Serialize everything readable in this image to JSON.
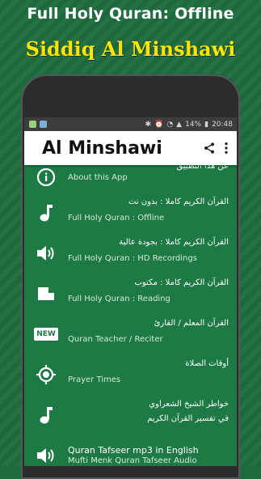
{
  "promo": {
    "title": "Full Holy Quran: Offline",
    "subtitle": "Siddiq Al Minshawi"
  },
  "status_bar": {
    "battery": "14%",
    "time": "20:48"
  },
  "app_bar": {
    "title": "Al Minshawi",
    "share_icon": "share-icon",
    "menu_icon": "more-vert-icon"
  },
  "menu": {
    "items": [
      {
        "icon": "info-icon",
        "ar": "عن هذا التطبيق",
        "en": "About this App"
      },
      {
        "icon": "music-note-icon",
        "ar": "القرآن الكريم كاملا : بدون نت",
        "en": "Full Holy Quran : Offline"
      },
      {
        "icon": "volume-icon",
        "ar": "القرآن الكريم كاملا : بجودة عالية",
        "en": "Full Holy Quran : HD Recordings"
      },
      {
        "icon": "document-icon",
        "ar": "القرآن الكريم كاملا : مكتوب",
        "en": "Full Holy Quran : Reading"
      },
      {
        "icon": "new-badge-icon",
        "ar": "القرآن المعلم / القارئ",
        "en": "Quran Teacher / Reciter"
      },
      {
        "icon": "gps-target-icon",
        "ar": "أوقات الصلاة",
        "en": "Prayer Times"
      },
      {
        "icon": "music-note-icon",
        "ar": "خواطر الشيخ الشعراوي",
        "en": "في تفسير القرآن الكريم"
      },
      {
        "icon": "volume-icon",
        "ar": "",
        "en_title": "Quran Tafseer mp3 in English",
        "en": "Mufti Menk Quran Tafseer Audio"
      }
    ],
    "new_badge_text": "NEW"
  }
}
